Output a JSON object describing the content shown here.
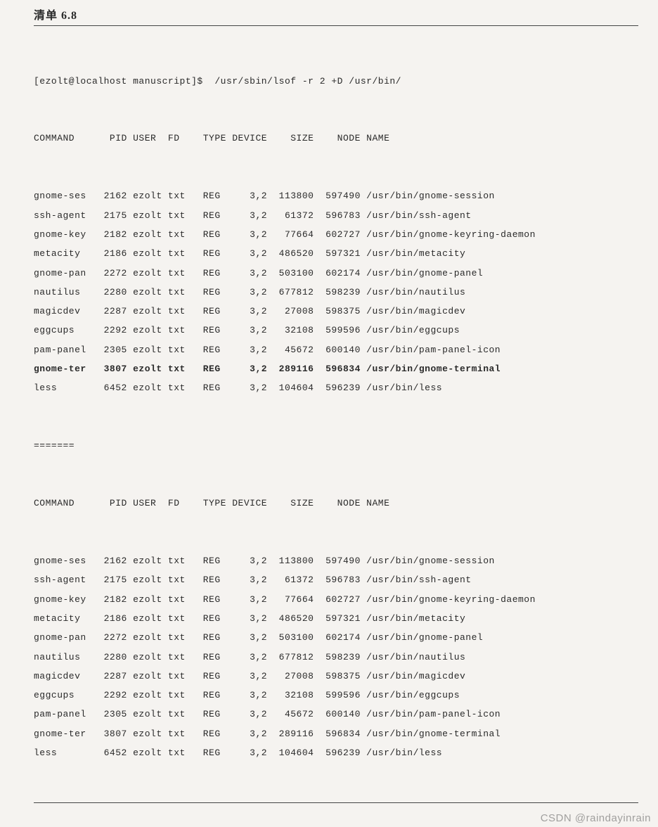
{
  "title": "清单 6.8",
  "prompt": "[ezolt@localhost manuscript]$  /usr/sbin/lsof -r 2 +D /usr/bin/",
  "header": {
    "command": "COMMAND",
    "pid": "PID",
    "user": "USER",
    "fd": "FD",
    "type": "TYPE",
    "device": "DEVICE",
    "size": "SIZE",
    "node": "NODE",
    "name": "NAME"
  },
  "block1": [
    {
      "command": "gnome-ses",
      "pid": "2162",
      "user": "ezolt",
      "fd": "txt",
      "type": "REG",
      "device": "3,2",
      "size": "113800",
      "node": "597490",
      "name": "/usr/bin/gnome-session",
      "bold": false
    },
    {
      "command": "ssh-agent",
      "pid": "2175",
      "user": "ezolt",
      "fd": "txt",
      "type": "REG",
      "device": "3,2",
      "size": "61372",
      "node": "596783",
      "name": "/usr/bin/ssh-agent",
      "bold": false
    },
    {
      "command": "gnome-key",
      "pid": "2182",
      "user": "ezolt",
      "fd": "txt",
      "type": "REG",
      "device": "3,2",
      "size": "77664",
      "node": "602727",
      "name": "/usr/bin/gnome-keyring-daemon",
      "bold": false
    },
    {
      "command": "metacity",
      "pid": "2186",
      "user": "ezolt",
      "fd": "txt",
      "type": "REG",
      "device": "3,2",
      "size": "486520",
      "node": "597321",
      "name": "/usr/bin/metacity",
      "bold": false
    },
    {
      "command": "gnome-pan",
      "pid": "2272",
      "user": "ezolt",
      "fd": "txt",
      "type": "REG",
      "device": "3,2",
      "size": "503100",
      "node": "602174",
      "name": "/usr/bin/gnome-panel",
      "bold": false
    },
    {
      "command": "nautilus",
      "pid": "2280",
      "user": "ezolt",
      "fd": "txt",
      "type": "REG",
      "device": "3,2",
      "size": "677812",
      "node": "598239",
      "name": "/usr/bin/nautilus",
      "bold": false
    },
    {
      "command": "magicdev",
      "pid": "2287",
      "user": "ezolt",
      "fd": "txt",
      "type": "REG",
      "device": "3,2",
      "size": "27008",
      "node": "598375",
      "name": "/usr/bin/magicdev",
      "bold": false
    },
    {
      "command": "eggcups",
      "pid": "2292",
      "user": "ezolt",
      "fd": "txt",
      "type": "REG",
      "device": "3,2",
      "size": "32108",
      "node": "599596",
      "name": "/usr/bin/eggcups",
      "bold": false
    },
    {
      "command": "pam-panel",
      "pid": "2305",
      "user": "ezolt",
      "fd": "txt",
      "type": "REG",
      "device": "3,2",
      "size": "45672",
      "node": "600140",
      "name": "/usr/bin/pam-panel-icon",
      "bold": false
    },
    {
      "command": "gnome-ter",
      "pid": "3807",
      "user": "ezolt",
      "fd": "txt",
      "type": "REG",
      "device": "3,2",
      "size": "289116",
      "node": "596834",
      "name": "/usr/bin/gnome-terminal",
      "bold": true
    },
    {
      "command": "less",
      "pid": "6452",
      "user": "ezolt",
      "fd": "txt",
      "type": "REG",
      "device": "3,2",
      "size": "104604",
      "node": "596239",
      "name": "/usr/bin/less",
      "bold": false
    }
  ],
  "separator": "=======",
  "block2": [
    {
      "command": "gnome-ses",
      "pid": "2162",
      "user": "ezolt",
      "fd": "txt",
      "type": "REG",
      "device": "3,2",
      "size": "113800",
      "node": "597490",
      "name": "/usr/bin/gnome-session"
    },
    {
      "command": "ssh-agent",
      "pid": "2175",
      "user": "ezolt",
      "fd": "txt",
      "type": "REG",
      "device": "3,2",
      "size": "61372",
      "node": "596783",
      "name": "/usr/bin/ssh-agent"
    },
    {
      "command": "gnome-key",
      "pid": "2182",
      "user": "ezolt",
      "fd": "txt",
      "type": "REG",
      "device": "3,2",
      "size": "77664",
      "node": "602727",
      "name": "/usr/bin/gnome-keyring-daemon"
    },
    {
      "command": "metacity",
      "pid": "2186",
      "user": "ezolt",
      "fd": "txt",
      "type": "REG",
      "device": "3,2",
      "size": "486520",
      "node": "597321",
      "name": "/usr/bin/metacity"
    },
    {
      "command": "gnome-pan",
      "pid": "2272",
      "user": "ezolt",
      "fd": "txt",
      "type": "REG",
      "device": "3,2",
      "size": "503100",
      "node": "602174",
      "name": "/usr/bin/gnome-panel"
    },
    {
      "command": "nautilus",
      "pid": "2280",
      "user": "ezolt",
      "fd": "txt",
      "type": "REG",
      "device": "3,2",
      "size": "677812",
      "node": "598239",
      "name": "/usr/bin/nautilus"
    },
    {
      "command": "magicdev",
      "pid": "2287",
      "user": "ezolt",
      "fd": "txt",
      "type": "REG",
      "device": "3,2",
      "size": "27008",
      "node": "598375",
      "name": "/usr/bin/magicdev"
    },
    {
      "command": "eggcups",
      "pid": "2292",
      "user": "ezolt",
      "fd": "txt",
      "type": "REG",
      "device": "3,2",
      "size": "32108",
      "node": "599596",
      "name": "/usr/bin/eggcups"
    },
    {
      "command": "pam-panel",
      "pid": "2305",
      "user": "ezolt",
      "fd": "txt",
      "type": "REG",
      "device": "3,2",
      "size": "45672",
      "node": "600140",
      "name": "/usr/bin/pam-panel-icon"
    },
    {
      "command": "gnome-ter",
      "pid": "3807",
      "user": "ezolt",
      "fd": "txt",
      "type": "REG",
      "device": "3,2",
      "size": "289116",
      "node": "596834",
      "name": "/usr/bin/gnome-terminal"
    },
    {
      "command": "less",
      "pid": "6452",
      "user": "ezolt",
      "fd": "txt",
      "type": "REG",
      "device": "3,2",
      "size": "104604",
      "node": "596239",
      "name": "/usr/bin/less"
    }
  ],
  "watermark": "CSDN @raindayinrain"
}
